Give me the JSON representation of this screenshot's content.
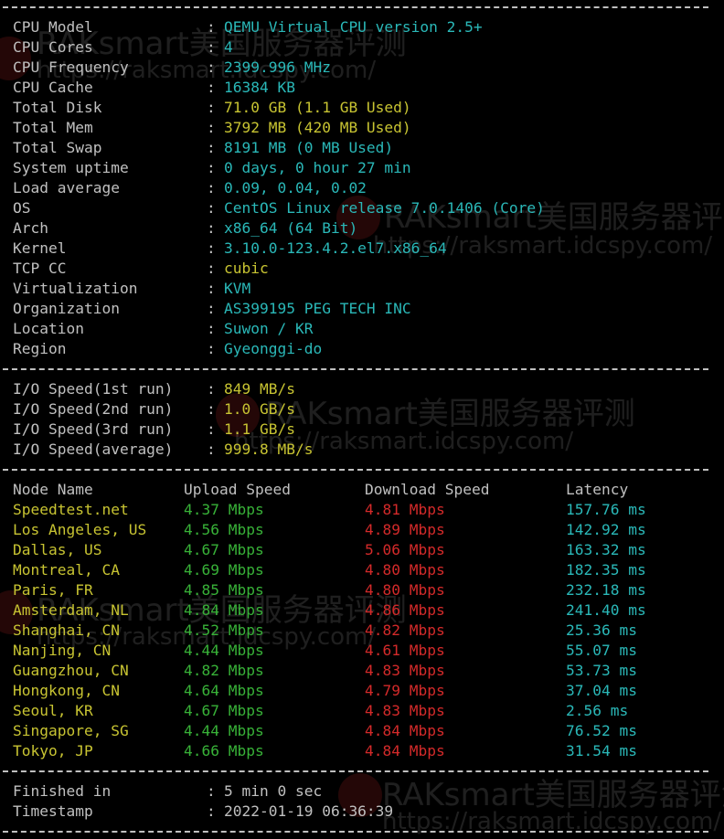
{
  "system": [
    {
      "label": "CPU Model",
      "value": "QEMU Virtual CPU version 2.5+",
      "color": "cyan"
    },
    {
      "label": "CPU Cores",
      "value": "4",
      "color": "cyan"
    },
    {
      "label": "CPU Frequency",
      "value": "2399.996 MHz",
      "color": "cyan"
    },
    {
      "label": "CPU Cache",
      "value": "16384 KB",
      "color": "cyan"
    },
    {
      "label": "Total Disk",
      "value": "71.0 GB (1.1 GB Used)",
      "color": "yellow"
    },
    {
      "label": "Total Mem",
      "value": "3792 MB (420 MB Used)",
      "color": "yellow"
    },
    {
      "label": "Total Swap",
      "value": "8191 MB (0 MB Used)",
      "color": "cyan"
    },
    {
      "label": "System uptime",
      "value": "0 days, 0 hour 27 min",
      "color": "cyan"
    },
    {
      "label": "Load average",
      "value": "0.09, 0.04, 0.02",
      "color": "cyan"
    },
    {
      "label": "OS",
      "value": "CentOS Linux release 7.0.1406 (Core)",
      "color": "cyan"
    },
    {
      "label": "Arch",
      "value": "x86_64 (64 Bit)",
      "color": "cyan"
    },
    {
      "label": "Kernel",
      "value": "3.10.0-123.4.2.el7.x86_64",
      "color": "cyan"
    },
    {
      "label": "TCP CC",
      "value": "cubic",
      "color": "yellow"
    },
    {
      "label": "Virtualization",
      "value": "KVM",
      "color": "cyan"
    },
    {
      "label": "Organization",
      "value": "AS399195 PEG TECH INC",
      "color": "cyan"
    },
    {
      "label": "Location",
      "value": "Suwon / KR",
      "color": "cyan"
    },
    {
      "label": "Region",
      "value": "Gyeonggi-do",
      "color": "cyan"
    }
  ],
  "io": [
    {
      "label": "I/O Speed(1st run)",
      "value": "849 MB/s"
    },
    {
      "label": "I/O Speed(2nd run)",
      "value": "1.0 GB/s"
    },
    {
      "label": "I/O Speed(3rd run)",
      "value": "1.1 GB/s"
    },
    {
      "label": "I/O Speed(average)",
      "value": "999.8 MB/s"
    }
  ],
  "speed_headers": {
    "node": "Node Name",
    "upload": "Upload Speed",
    "download": "Download Speed",
    "latency": "Latency"
  },
  "speed_rows": [
    {
      "node": "Speedtest.net",
      "upload": "4.37 Mbps",
      "download": "4.81 Mbps",
      "latency": "157.76 ms"
    },
    {
      "node": "Los Angeles, US",
      "upload": "4.56 Mbps",
      "download": "4.89 Mbps",
      "latency": "142.92 ms"
    },
    {
      "node": "Dallas, US",
      "upload": "4.67 Mbps",
      "download": "5.06 Mbps",
      "latency": "163.32 ms"
    },
    {
      "node": "Montreal, CA",
      "upload": "4.69 Mbps",
      "download": "4.80 Mbps",
      "latency": "182.35 ms"
    },
    {
      "node": "Paris, FR",
      "upload": "4.85 Mbps",
      "download": "4.80 Mbps",
      "latency": "232.18 ms"
    },
    {
      "node": "Amsterdam, NL",
      "upload": "4.84 Mbps",
      "download": "4.86 Mbps",
      "latency": "241.40 ms"
    },
    {
      "node": "Shanghai, CN",
      "upload": "4.52 Mbps",
      "download": "4.82 Mbps",
      "latency": "25.36 ms"
    },
    {
      "node": "Nanjing, CN",
      "upload": "4.44 Mbps",
      "download": "4.61 Mbps",
      "latency": "55.07 ms"
    },
    {
      "node": "Guangzhou, CN",
      "upload": "4.82 Mbps",
      "download": "4.83 Mbps",
      "latency": "53.73 ms"
    },
    {
      "node": "Hongkong, CN",
      "upload": "4.64 Mbps",
      "download": "4.79 Mbps",
      "latency": "37.04 ms"
    },
    {
      "node": "Seoul, KR",
      "upload": "4.67 Mbps",
      "download": "4.83 Mbps",
      "latency": "2.56 ms"
    },
    {
      "node": "Singapore, SG",
      "upload": "4.44 Mbps",
      "download": "4.84 Mbps",
      "latency": "76.52 ms"
    },
    {
      "node": "Tokyo, JP",
      "upload": "4.66 Mbps",
      "download": "4.84 Mbps",
      "latency": "31.54 ms"
    }
  ],
  "summary": [
    {
      "label": "Finished in",
      "value": "5 min 0 sec"
    },
    {
      "label": "Timestamp",
      "value": "2022-01-19 06:36:39"
    }
  ],
  "watermark": {
    "brand": "RAKsmart美国服务器评测",
    "url": "https://raksmart.idcspy.com/"
  },
  "colors": {
    "background": "#000000",
    "label": "#c0c0c0",
    "cyan": "#2ab8b8",
    "yellow": "#c8c432",
    "green": "#38b238",
    "red": "#d42a2a"
  }
}
